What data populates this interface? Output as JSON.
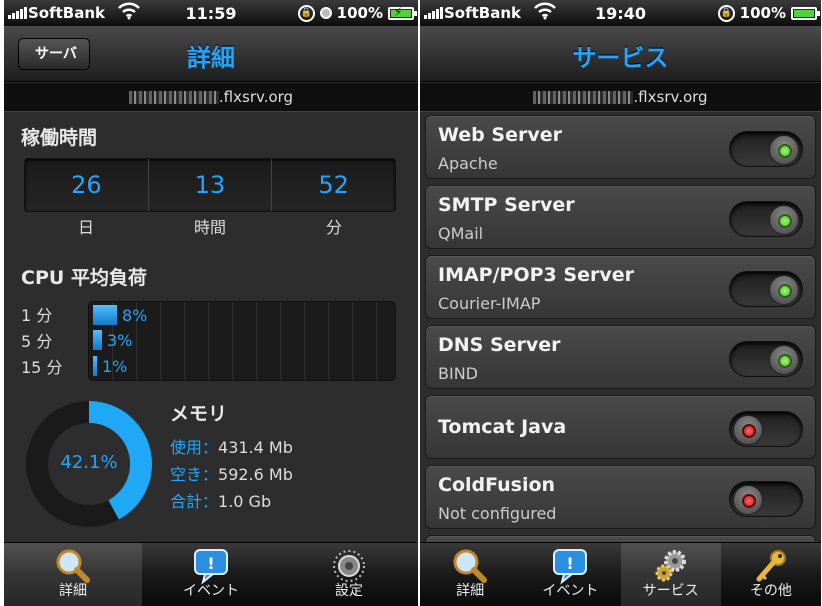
{
  "left": {
    "status": {
      "carrier": "SoftBank",
      "time": "11:59",
      "battery": "100%"
    },
    "nav": {
      "back_label": "サーバ",
      "title": "詳細"
    },
    "host": {
      "suffix": ".flxsrv.org"
    },
    "uptime": {
      "title": "稼働時間",
      "values": {
        "days": "26",
        "hours": "13",
        "minutes": "52"
      },
      "labels": {
        "days": "日",
        "hours": "時間",
        "minutes": "分"
      }
    },
    "cpu": {
      "title": "CPU 平均負荷",
      "rows": [
        {
          "label": "1 分",
          "text": "8%",
          "percent": 8
        },
        {
          "label": "5 分",
          "text": "3%",
          "percent": 3
        },
        {
          "label": "15 分",
          "text": "1%",
          "percent": 1
        }
      ]
    },
    "memory": {
      "title": "メモリ",
      "percent_text": "42.1%",
      "percent": 42.1,
      "used_label": "使用：",
      "used": "431.4 Mb",
      "free_label": "空き：",
      "free": "592.6 Mb",
      "total_label": "合計：",
      "total": "1.0 Gb"
    },
    "tabs": [
      {
        "label": "詳細",
        "icon": "magnifier-icon",
        "active": true
      },
      {
        "label": "イベント",
        "icon": "speech-bubble-icon",
        "active": false
      },
      {
        "label": "設定",
        "icon": "dial-icon",
        "active": false
      }
    ]
  },
  "right": {
    "status": {
      "carrier": "SoftBank",
      "time": "19:40",
      "battery": "100%"
    },
    "nav": {
      "title": "サービス"
    },
    "host": {
      "suffix": ".flxsrv.org"
    },
    "services": [
      {
        "name": "Web Server",
        "sub": "Apache",
        "on": true
      },
      {
        "name": "SMTP Server",
        "sub": "QMail",
        "on": true
      },
      {
        "name": "IMAP/POP3 Server",
        "sub": "Courier-IMAP",
        "on": true
      },
      {
        "name": "DNS Server",
        "sub": "BIND",
        "on": true
      },
      {
        "name": "Tomcat Java",
        "sub": "",
        "on": false
      },
      {
        "name": "ColdFusion",
        "sub": "Not configured",
        "on": false
      }
    ],
    "tabs": [
      {
        "label": "詳細",
        "icon": "magnifier-icon",
        "active": false
      },
      {
        "label": "イベント",
        "icon": "speech-bubble-icon",
        "active": false
      },
      {
        "label": "サービス",
        "icon": "gears-icon",
        "active": true
      },
      {
        "label": "その他",
        "icon": "key-icon",
        "active": false
      }
    ]
  },
  "colors": {
    "accent": "#1fa6ff",
    "toggle_on": "#4fc42a",
    "toggle_off": "#c01818"
  }
}
